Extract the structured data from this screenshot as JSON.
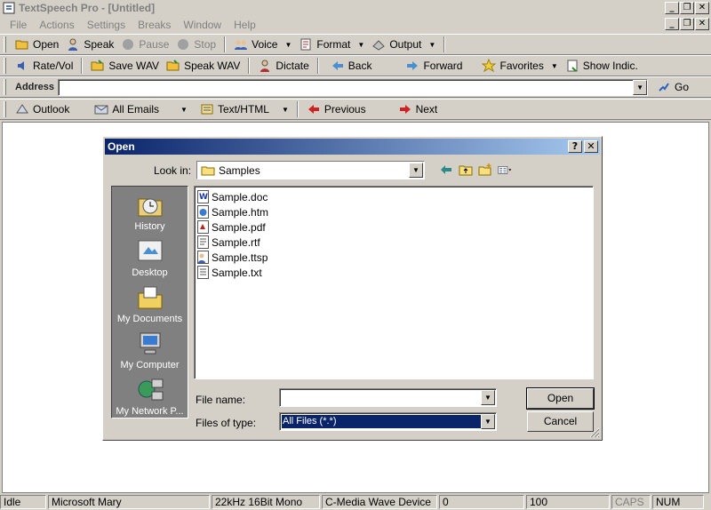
{
  "window": {
    "title": "TextSpeech Pro - [Untitled]"
  },
  "menu": [
    "File",
    "Actions",
    "Settings",
    "Breaks",
    "Window",
    "Help"
  ],
  "toolbar1": {
    "open": "Open",
    "speak": "Speak",
    "pause": "Pause",
    "stop": "Stop",
    "voice": "Voice",
    "format": "Format",
    "output": "Output"
  },
  "toolbar2": {
    "rate_vol": "Rate/Vol",
    "save_wav": "Save WAV",
    "speak_wav": "Speak WAV",
    "dictate": "Dictate",
    "back": "Back",
    "forward": "Forward",
    "favorites": "Favorites",
    "show_indic": "Show Indic."
  },
  "address": {
    "label": "Address",
    "value": "",
    "go": "Go"
  },
  "toolbar4": {
    "outlook": "Outlook",
    "all_emails": "All Emails",
    "text_html": "Text/HTML",
    "previous": "Previous",
    "next": "Next"
  },
  "dialog": {
    "title": "Open",
    "look_in_label": "Look in:",
    "look_in_value": "Samples",
    "places": [
      "History",
      "Desktop",
      "My Documents",
      "My Computer",
      "My Network P..."
    ],
    "files": [
      {
        "name": "Sample.doc",
        "icon": "word-doc-icon"
      },
      {
        "name": "Sample.htm",
        "icon": "html-file-icon"
      },
      {
        "name": "Sample.pdf",
        "icon": "pdf-file-icon"
      },
      {
        "name": "Sample.rtf",
        "icon": "rtf-file-icon"
      },
      {
        "name": "Sample.ttsp",
        "icon": "ttsp-file-icon"
      },
      {
        "name": "Sample.txt",
        "icon": "text-file-icon"
      }
    ],
    "file_name_label": "File name:",
    "file_name_value": "",
    "file_type_label": "Files of type:",
    "file_type_value": "All Files (*.*)",
    "open_button": "Open",
    "cancel_button": "Cancel"
  },
  "status": [
    "Idle",
    "Microsoft Mary",
    "22kHz 16Bit Mono",
    "C-Media Wave Device",
    "0",
    "100",
    "CAPS",
    "NUM"
  ],
  "colors": {
    "titlebar_active": "#0a246a",
    "face": "#d4d0c8",
    "selection": "#0a246a"
  }
}
